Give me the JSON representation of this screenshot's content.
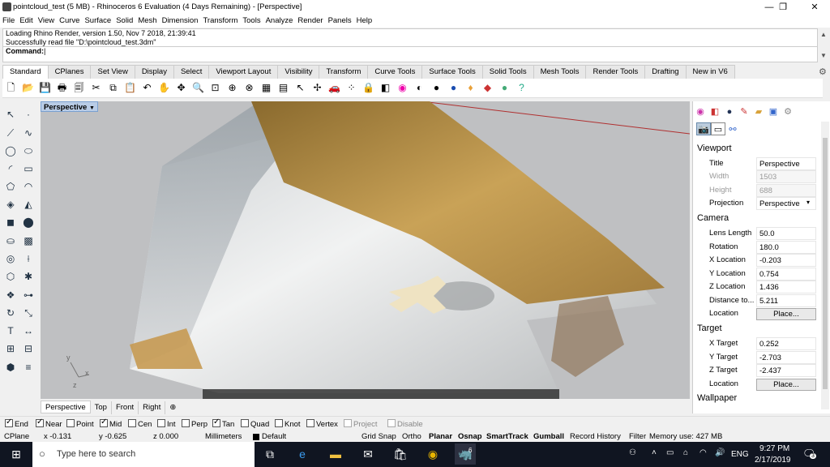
{
  "window": {
    "title": "pointcloud_test (5 MB) - Rhinoceros 6 Evaluation (4 Days Remaining) - [Perspective]"
  },
  "menu": [
    "File",
    "Edit",
    "View",
    "Curve",
    "Surface",
    "Solid",
    "Mesh",
    "Dimension",
    "Transform",
    "Tools",
    "Analyze",
    "Render",
    "Panels",
    "Help"
  ],
  "command": {
    "history": [
      "Loading Rhino Render, version 1.50, Nov  7 2018, 21:39:41",
      "Successfully read file \"D:\\pointcloud_test.3dm\""
    ],
    "prompt": "Command:"
  },
  "tabs": [
    "Standard",
    "CPlanes",
    "Set View",
    "Display",
    "Select",
    "Viewport Layout",
    "Visibility",
    "Transform",
    "Curve Tools",
    "Surface Tools",
    "Solid Tools",
    "Mesh Tools",
    "Render Tools",
    "Drafting",
    "New in V6"
  ],
  "active_tab": "Standard",
  "viewport": {
    "label": "Perspective",
    "tabs": [
      "Perspective",
      "Top",
      "Front",
      "Right"
    ],
    "axes": {
      "y": "y",
      "x": "x",
      "z": "z"
    }
  },
  "panel": {
    "viewport_section": "Viewport",
    "title_label": "Title",
    "title_value": "Perspective",
    "width_label": "Width",
    "width_value": "1503",
    "height_label": "Height",
    "height_value": "688",
    "projection_label": "Projection",
    "projection_value": "Perspective",
    "camera_section": "Camera",
    "lens_label": "Lens Length",
    "lens_value": "50.0",
    "rotation_label": "Rotation",
    "rotation_value": "180.0",
    "xloc_label": "X Location",
    "xloc_value": "-0.203",
    "yloc_label": "Y Location",
    "yloc_value": "0.754",
    "zloc_label": "Z Location",
    "zloc_value": "1.436",
    "dist_label": "Distance to...",
    "dist_value": "5.211",
    "loc_label": "Location",
    "place_label": "Place...",
    "target_section": "Target",
    "xt_label": "X Target",
    "xt_value": "0.252",
    "yt_label": "Y Target",
    "yt_value": "-2.703",
    "zt_label": "Z Target",
    "zt_value": "-2.437",
    "tloc_label": "Location",
    "tplace_label": "Place...",
    "wallpaper_section": "Wallpaper"
  },
  "osnap": {
    "end": "End",
    "near": "Near",
    "point": "Point",
    "mid": "Mid",
    "cen": "Cen",
    "int": "Int",
    "perp": "Perp",
    "tan": "Tan",
    "quad": "Quad",
    "knot": "Knot",
    "vertex": "Vertex",
    "project": "Project",
    "disable": "Disable"
  },
  "status": {
    "cplane": "CPlane",
    "x": "x -0.131",
    "y": "y -0.625",
    "z": "z 0.000",
    "units": "Millimeters",
    "layer": "Default",
    "grid_snap": "Grid Snap",
    "ortho": "Ortho",
    "planar": "Planar",
    "osnap": "Osnap",
    "smarttrack": "SmartTrack",
    "gumball": "Gumball",
    "record": "Record History",
    "filter": "Filter",
    "memory": "Memory use: 427 MB"
  },
  "taskbar": {
    "search": "Type here to search",
    "time": "9:27 PM",
    "date": "2/17/2019",
    "lang": "ENG",
    "notifications": "3",
    "rhino_badge": "6"
  }
}
